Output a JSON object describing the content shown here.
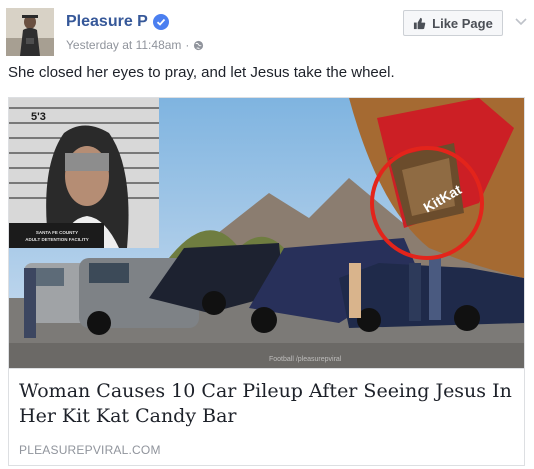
{
  "post": {
    "page_name": "Pleasure P",
    "timestamp": "Yesterday at 11:48am",
    "separator": "·",
    "like_button": "Like Page",
    "text": "She closed her eyes to pray, and let Jesus take the wheel."
  },
  "link_card": {
    "title": "Woman Causes 10 Car Pileup After Seeing Jesus In Her Kit Kat Candy Bar",
    "domain": "PLEASUREPVIRAL.COM",
    "image_caption": "Santa Fe County Adult Detention Facility",
    "height_marker": "5'3",
    "watermark": "Football /pleasurepviral"
  },
  "colors": {
    "brand_blue": "#365899",
    "verified_blue": "#4b7ff0",
    "meta_grey": "#90949c",
    "border": "#dddfe2"
  },
  "icons": [
    "avatar",
    "verified-badge-icon",
    "globe-icon",
    "thumbs-up-icon",
    "chevron-down-icon"
  ]
}
